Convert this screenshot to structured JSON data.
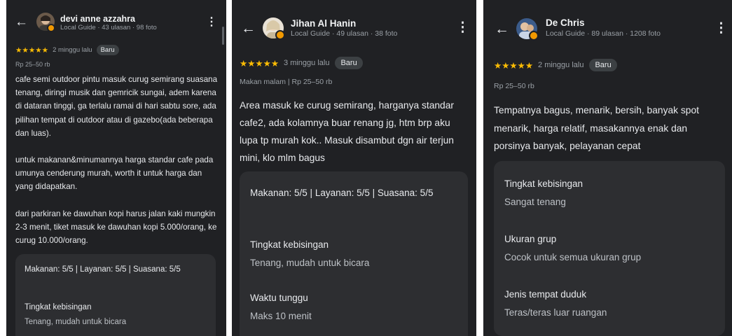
{
  "panels": [
    {
      "user_name": "devi anne azzahra",
      "user_meta": "Local Guide · 43 ulasan · 98 foto",
      "stars": "★★★★★",
      "time_ago": "2 minggu lalu",
      "new_badge": "Baru",
      "price_line": "Rp 25–50 rb",
      "paragraphs": [
        "cafe semi outdoor pintu masuk curug semirang suasana tenang, diringi musik dan gemricik sungai, adem karena di dataran tinggi, ga terlalu ramai di hari sabtu sore, ada pilihan tempat di outdoor atau di gazebo(ada beberapa dan luas).",
        "untuk makanan&minumannya harga standar cafe pada umunya cenderung murah, worth it untuk harga dan yang didapatkan.",
        "dari parkiran ke dawuhan kopi harus jalan kaki mungkin 2-3 menit, tiket masuk ke dawuhan kopi 5.000/orang, ke curug 10.000/orang."
      ],
      "card": {
        "ratings": "Makanan: 5/5  |  Layanan: 5/5  |  Suasana: 5/5",
        "attr1_label": "Tingkat kebisingan",
        "attr1_value": "Tenang, mudah untuk bicara"
      }
    },
    {
      "user_name": "Jihan Al Hanin",
      "user_meta": "Local Guide · 49 ulasan · 38 foto",
      "stars": "★★★★★",
      "time_ago": "3 minggu lalu",
      "new_badge": "Baru",
      "price_line": "Makan malam  |  Rp 25–50 rb",
      "paragraphs": [
        "Area masuk ke curug semirang, harganya standar cafe2, ada kolamnya buar renang jg, htm brp aku lupa tp murah kok.. Masuk disambut dgn air terjun mini, klo mlm bagus"
      ],
      "card": {
        "ratings": "Makanan: 5/5  |  Layanan: 5/5  |  Suasana: 5/5",
        "attr1_label": "Tingkat kebisingan",
        "attr1_value": "Tenang, mudah untuk bicara",
        "attr2_label": "Waktu tunggu",
        "attr2_value": "Maks 10 menit"
      }
    },
    {
      "user_name": "De Chris",
      "user_meta": "Local Guide · 89 ulasan · 1208 foto",
      "stars": "★★★★★",
      "time_ago": "2 minggu lalu",
      "new_badge": "Baru",
      "price_line": "Rp 25–50 rb",
      "paragraphs": [
        "Tempatnya bagus, menarik, bersih, banyak spot menarik, harga relatif, masakannya enak dan porsinya banyak, pelayanan cepat"
      ],
      "card": {
        "attr1_label": "Tingkat kebisingan",
        "attr1_value": "Sangat tenang",
        "attr2_label": "Ukuran grup",
        "attr2_value": "Cocok untuk semua ukuran grup",
        "attr3_label": "Jenis tempat duduk",
        "attr3_value": "Teras/teras luar ruangan"
      }
    }
  ],
  "icons": {
    "back": "←",
    "more": "⋮"
  },
  "colors": {
    "background": "#202124",
    "card": "#2d2e31",
    "star": "#fbbc04",
    "local_guide_badge": "#f29900",
    "text_primary": "#e8eaed",
    "text_secondary": "#9aa0a6"
  }
}
